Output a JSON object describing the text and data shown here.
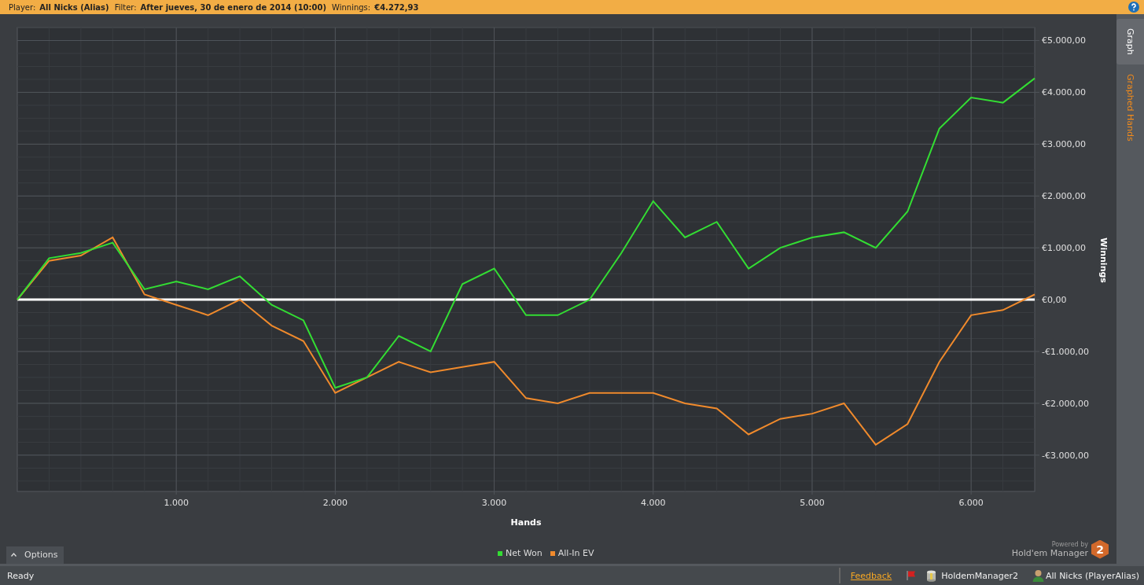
{
  "filter_bar": {
    "items": [
      {
        "label": "Player:",
        "value": "All Nicks (Alias)"
      },
      {
        "label": "Filter:",
        "value": "After jueves, 30 de enero de 2014 (10:00)"
      },
      {
        "label": "Winnings:",
        "value": "€4.272,93"
      }
    ]
  },
  "side_tabs": [
    {
      "label": "Graph",
      "selected": true
    },
    {
      "label": "Graphed Hands",
      "selected": false
    }
  ],
  "chart_data": {
    "type": "line",
    "grid": true,
    "xlabel": "Hands",
    "ylabel": "Winnings",
    "xlim": [
      0,
      6400
    ],
    "ylim": [
      -3700,
      5250
    ],
    "xticks": [
      {
        "value": 1000,
        "label": "1.000"
      },
      {
        "value": 2000,
        "label": "2.000"
      },
      {
        "value": 3000,
        "label": "3.000"
      },
      {
        "value": 4000,
        "label": "4.000"
      },
      {
        "value": 5000,
        "label": "5.000"
      },
      {
        "value": 6000,
        "label": "6.000"
      }
    ],
    "yticks": [
      {
        "value": -3000,
        "label": "-€3.000,00"
      },
      {
        "value": -2000,
        "label": "-€2.000,00"
      },
      {
        "value": -1000,
        "label": "-€1.000,00"
      },
      {
        "value": 0,
        "label": "€0,00"
      },
      {
        "value": 1000,
        "label": "€1.000,00"
      },
      {
        "value": 2000,
        "label": "€2.000,00"
      },
      {
        "value": 3000,
        "label": "€3.000,00"
      },
      {
        "value": 4000,
        "label": "€4.000,00"
      },
      {
        "value": 5000,
        "label": "€5.000,00"
      }
    ],
    "x": [
      0,
      200,
      400,
      600,
      800,
      1000,
      1200,
      1400,
      1600,
      1800,
      2000,
      2200,
      2400,
      2600,
      2800,
      3000,
      3200,
      3400,
      3600,
      3800,
      4000,
      4200,
      4400,
      4600,
      4800,
      5000,
      5200,
      5400,
      5600,
      5800,
      6000,
      6200,
      6400
    ],
    "series": [
      {
        "name": "Net Won",
        "color": "#33dd33",
        "values": [
          0,
          800,
          900,
          1100,
          200,
          350,
          200,
          450,
          -100,
          -400,
          -1700,
          -1500,
          -700,
          -1000,
          300,
          600,
          -300,
          -300,
          0,
          900,
          1900,
          1200,
          1500,
          600,
          1000,
          1200,
          1300,
          1000,
          1700,
          3300,
          3900,
          3800,
          4270
        ]
      },
      {
        "name": "All-In EV",
        "color": "#f08a2c",
        "values": [
          0,
          750,
          850,
          1200,
          100,
          -100,
          -300,
          0,
          -500,
          -800,
          -1800,
          -1500,
          -1200,
          -1400,
          -1300,
          -1200,
          -1900,
          -2000,
          -1800,
          -1800,
          -1800,
          -2000,
          -2100,
          -2600,
          -2300,
          -2200,
          -2000,
          -2800,
          -2400,
          -1200,
          -300,
          -200,
          100
        ]
      }
    ]
  },
  "options_button": {
    "label": "Options"
  },
  "branding": {
    "powered_by": "Powered by",
    "product": "Hold'em Manager",
    "badge": "2"
  },
  "status_bar": {
    "status": "Ready",
    "link": "Feedback",
    "app": "HoldemManager2",
    "user": "All Nicks (PlayerAlias)"
  }
}
